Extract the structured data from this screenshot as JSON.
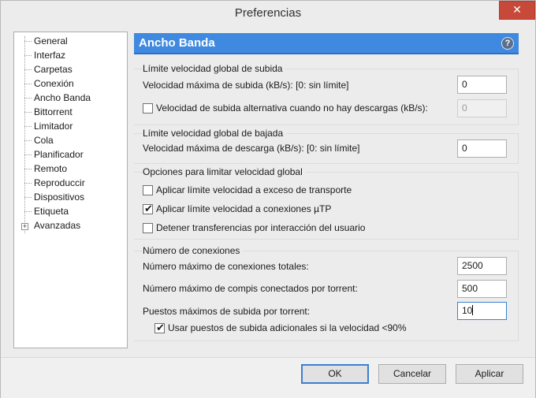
{
  "window": {
    "title": "Preferencias",
    "close_glyph": "✕"
  },
  "sidebar": {
    "items": [
      {
        "label": "General"
      },
      {
        "label": "Interfaz"
      },
      {
        "label": "Carpetas"
      },
      {
        "label": "Conexión"
      },
      {
        "label": "Ancho Banda"
      },
      {
        "label": "Bittorrent"
      },
      {
        "label": "Limitador"
      },
      {
        "label": "Cola"
      },
      {
        "label": "Planificador"
      },
      {
        "label": "Remoto"
      },
      {
        "label": "Reproduccir"
      },
      {
        "label": "Dispositivos"
      },
      {
        "label": "Etiqueta"
      },
      {
        "label": "Avanzadas"
      }
    ],
    "expander_glyph": "+"
  },
  "panel": {
    "title": "Ancho Banda",
    "help_glyph": "?",
    "upload": {
      "title": "Límite velocidad global de subida",
      "max_label": "Velocidad máxima de subida (kB/s): [0: sin límite]",
      "max_value": "0",
      "alt_label": "Velocidad de subida alternativa cuando no hay descargas (kB/s):",
      "alt_checked": false,
      "alt_value": "0"
    },
    "download": {
      "title": "Límite velocidad global de bajada",
      "max_label": "Velocidad máxima de descarga (kB/s): [0: sin límite]",
      "max_value": "0"
    },
    "options": {
      "title": "Opciones para limitar velocidad global",
      "items": [
        {
          "label": "Aplicar límite velocidad a exceso de transporte",
          "checked": false
        },
        {
          "label": "Aplicar límite velocidad a conexiones µTP",
          "checked": true
        },
        {
          "label": "Detener transferencias por interacción del usuario",
          "checked": false
        }
      ]
    },
    "connections": {
      "title": "Número de conexiones",
      "total_label": "Número máximo de conexiones totales:",
      "total_value": "2500",
      "peers_label": "Número máximo de compis conectados por torrent:",
      "peers_value": "500",
      "slots_label": "Puestos máximos de subida por torrent:",
      "slots_value": "10",
      "extra_label": "Usar puestos de subida adicionales si la velocidad <90%",
      "extra_checked": true
    }
  },
  "buttons": {
    "ok": "OK",
    "cancel": "Cancelar",
    "apply": "Aplicar"
  },
  "colors": {
    "accent": "#3f8ae0",
    "close": "#c7493a"
  }
}
